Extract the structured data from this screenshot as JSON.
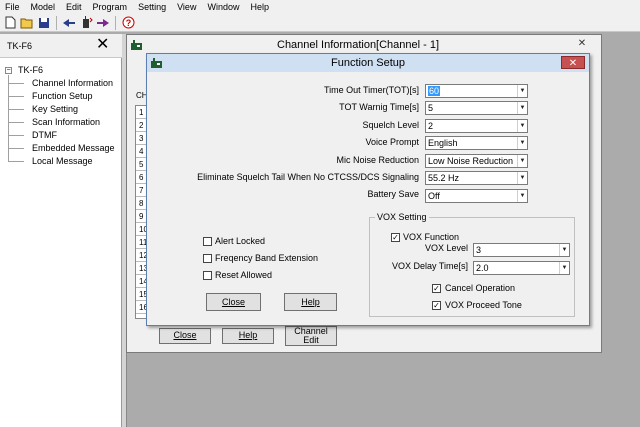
{
  "menubar": [
    "File",
    "Model",
    "Edit",
    "Program",
    "Setting",
    "View",
    "Window",
    "Help"
  ],
  "toolbar_icons": [
    "new-icon",
    "open-icon",
    "save-icon",
    "read-icon",
    "radio-icon",
    "write-icon",
    "help-icon"
  ],
  "leftpanel": {
    "title": "TK-F6",
    "close_glyph": "✕",
    "root": "TK-F6",
    "items": [
      "Channel Information",
      "Function Setup",
      "Key Setting",
      "Scan Information",
      "DTMF",
      "Embedded Message",
      "Local Message"
    ]
  },
  "channel_window": {
    "title": "Channel Information[Channel - 1]",
    "col_header": "CH",
    "rows": [
      "1",
      "2",
      "3",
      "4",
      "5",
      "6",
      "7",
      "8",
      "9",
      "10",
      "11",
      "12",
      "13",
      "14",
      "15",
      "16"
    ],
    "close_label": "Close",
    "help_label": "Help",
    "edit_label_line1": "Channel",
    "edit_label_line2": "Edit"
  },
  "dialog": {
    "title": "Function Setup",
    "close_glyph": "✕",
    "fields": {
      "tot": {
        "label": "Time Out Timer(TOT)[s]",
        "value": "60"
      },
      "tot_warning": {
        "label": "TOT Warnig Time[s]",
        "value": "5"
      },
      "squelch": {
        "label": "Squelch Level",
        "value": "2"
      },
      "voice_prompt": {
        "label": "Voice Prompt",
        "value": "English"
      },
      "mic_noise": {
        "label": "Mic Noise Reduction",
        "value": "Low Noise Reduction"
      },
      "squelch_tail": {
        "label": "Eliminate Squelch Tail When No CTCSS/DCS Signaling",
        "value": "55.2 Hz"
      },
      "battery_save": {
        "label": "Battery Save",
        "value": "Off"
      }
    },
    "checkboxes": {
      "alert_locked": {
        "label": "Alert Locked",
        "checked": false
      },
      "freq_band": {
        "label": "Freqency Band Extension",
        "checked": false
      },
      "reset_allowed": {
        "label": "Reset Allowed",
        "checked": false
      }
    },
    "vox": {
      "legend": "VOX Setting",
      "function": {
        "label": "VOX Function",
        "checked": true
      },
      "level": {
        "label": "VOX Level",
        "value": "3"
      },
      "delay": {
        "label": "VOX Delay Time[s]",
        "value": "2.0"
      },
      "cancel_op": {
        "label": "Cancel Operation",
        "checked": true
      },
      "proceed_tone": {
        "label": "VOX Proceed Tone",
        "checked": true
      }
    },
    "close_label": "Close",
    "help_label": "Help"
  },
  "colors": {
    "selection": "#3399ff",
    "dialog_close": "#c75050",
    "workspace": "#ababab"
  }
}
